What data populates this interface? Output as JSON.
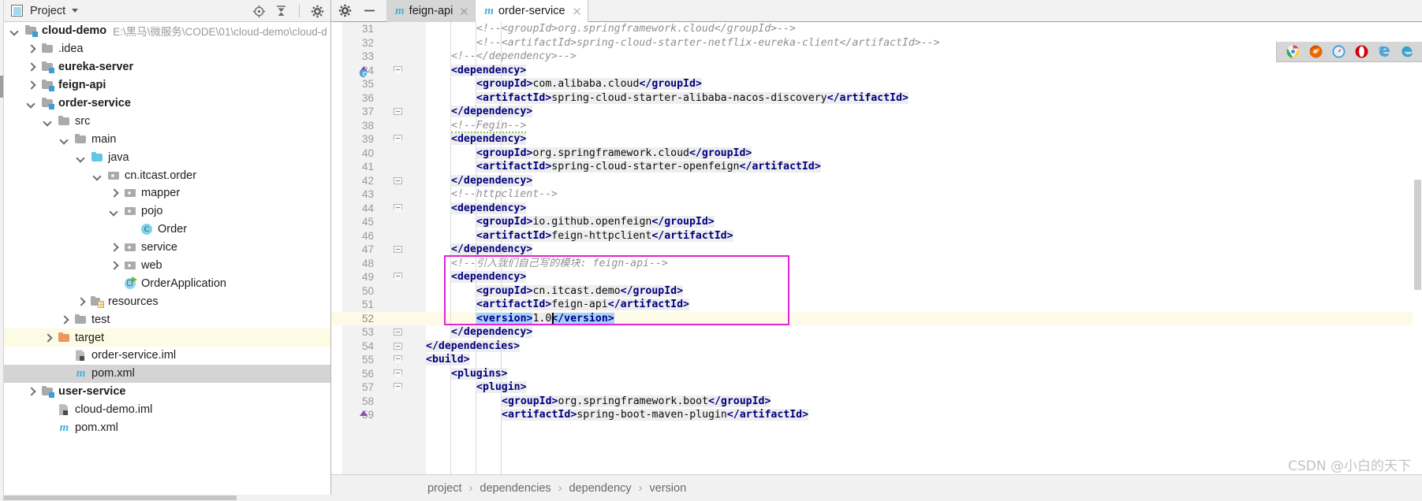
{
  "project_panel": {
    "title": "Project",
    "icons": [
      {
        "name": "locate-icon",
        "glyph": "target"
      },
      {
        "name": "collapse-all-icon",
        "glyph": "collapse"
      },
      {
        "name": "settings-gear-icon",
        "glyph": "gear"
      },
      {
        "name": "hide-icon",
        "glyph": "minus"
      }
    ],
    "tree": [
      {
        "label": "cloud-demo",
        "path": "E:\\黑马\\微服务\\CODE\\01\\cloud-demo\\cloud-d",
        "indent": 0,
        "arrow": "down",
        "icon": "module-folder-icon",
        "bold": true,
        "state": "none"
      },
      {
        "label": ".idea",
        "path": "",
        "indent": 1,
        "arrow": "right",
        "icon": "folder-icon",
        "bold": false,
        "state": "none"
      },
      {
        "label": "eureka-server",
        "path": "",
        "indent": 1,
        "arrow": "right",
        "icon": "module-folder-icon",
        "bold": true,
        "state": "none"
      },
      {
        "label": "feign-api",
        "path": "",
        "indent": 1,
        "arrow": "right",
        "icon": "module-folder-icon",
        "bold": true,
        "state": "none"
      },
      {
        "label": "order-service",
        "path": "",
        "indent": 1,
        "arrow": "down",
        "icon": "module-folder-icon",
        "bold": true,
        "state": "none"
      },
      {
        "label": "src",
        "path": "",
        "indent": 2,
        "arrow": "down",
        "icon": "folder-icon",
        "bold": false,
        "state": "none"
      },
      {
        "label": "main",
        "path": "",
        "indent": 3,
        "arrow": "down",
        "icon": "folder-icon",
        "bold": false,
        "state": "none"
      },
      {
        "label": "java",
        "path": "",
        "indent": 4,
        "arrow": "down",
        "icon": "source-folder-icon",
        "bold": false,
        "state": "none"
      },
      {
        "label": "cn.itcast.order",
        "path": "",
        "indent": 5,
        "arrow": "down",
        "icon": "package-icon",
        "bold": false,
        "state": "none"
      },
      {
        "label": "mapper",
        "path": "",
        "indent": 6,
        "arrow": "right",
        "icon": "package-icon",
        "bold": false,
        "state": "none"
      },
      {
        "label": "pojo",
        "path": "",
        "indent": 6,
        "arrow": "down",
        "icon": "package-icon",
        "bold": false,
        "state": "none"
      },
      {
        "label": "Order",
        "path": "",
        "indent": 7,
        "arrow": "none",
        "icon": "java-class-icon",
        "bold": false,
        "state": "none"
      },
      {
        "label": "service",
        "path": "",
        "indent": 6,
        "arrow": "right",
        "icon": "package-icon",
        "bold": false,
        "state": "none"
      },
      {
        "label": "web",
        "path": "",
        "indent": 6,
        "arrow": "right",
        "icon": "package-icon",
        "bold": false,
        "state": "none"
      },
      {
        "label": "OrderApplication",
        "path": "",
        "indent": 6,
        "arrow": "none",
        "icon": "spring-boot-class-icon",
        "bold": false,
        "state": "none"
      },
      {
        "label": "resources",
        "path": "",
        "indent": 4,
        "arrow": "right",
        "icon": "resources-folder-icon",
        "bold": false,
        "state": "none"
      },
      {
        "label": "test",
        "path": "",
        "indent": 3,
        "arrow": "right",
        "icon": "folder-icon",
        "bold": false,
        "state": "none"
      },
      {
        "label": "target",
        "path": "",
        "indent": 2,
        "arrow": "right",
        "icon": "target-folder-icon",
        "bold": false,
        "state": "yellow"
      },
      {
        "label": "order-service.iml",
        "path": "",
        "indent": 3,
        "arrow": "none",
        "icon": "iml-file-icon",
        "bold": false,
        "state": "none"
      },
      {
        "label": "pom.xml",
        "path": "",
        "indent": 3,
        "arrow": "none",
        "icon": "maven-file-icon",
        "bold": false,
        "state": "selected"
      },
      {
        "label": "user-service",
        "path": "",
        "indent": 1,
        "arrow": "right",
        "icon": "module-folder-icon",
        "bold": true,
        "state": "none"
      },
      {
        "label": "cloud-demo.iml",
        "path": "",
        "indent": 2,
        "arrow": "none",
        "icon": "iml-file-icon",
        "bold": false,
        "state": "none"
      },
      {
        "label": "pom.xml",
        "path": "",
        "indent": 2,
        "arrow": "none",
        "icon": "maven-file-icon",
        "bold": false,
        "state": "none"
      }
    ]
  },
  "editor": {
    "tabs": [
      {
        "label": "feign-api",
        "icon": "maven-file-icon",
        "active": false
      },
      {
        "label": "order-service",
        "icon": "maven-file-icon",
        "active": true
      }
    ],
    "toolbar_icons": [
      {
        "name": "settings-gear-icon"
      },
      {
        "name": "hide-window-icon"
      }
    ],
    "browser_icons": [
      {
        "name": "chrome-browser-icon",
        "color": "#4caf50"
      },
      {
        "name": "firefox-browser-icon",
        "color": "#e8650d"
      },
      {
        "name": "safari-browser-icon",
        "color": "#3f9ee0"
      },
      {
        "name": "opera-browser-icon",
        "color": "#d4000f"
      },
      {
        "name": "internet-explorer-browser-icon",
        "color": "#4ba3d8"
      },
      {
        "name": "edge-browser-icon",
        "color": "#2fa3d6"
      }
    ],
    "first_line_number": 31,
    "highlighted_line": 52,
    "caret_line": 52,
    "lines": [
      {
        "n": 31,
        "indent": 2,
        "fold": "none",
        "marker": "none",
        "tokens": [
          {
            "t": "cmt",
            "s": "<!--<groupId>org.springframework.cloud</groupId>-->"
          }
        ]
      },
      {
        "n": 32,
        "indent": 2,
        "fold": "none",
        "marker": "none",
        "tokens": [
          {
            "t": "cmt",
            "s": "<!--<artifactId>spring-cloud-starter-netflix-eureka-client</artifactId>-->"
          }
        ]
      },
      {
        "n": 33,
        "indent": 1,
        "fold": "none",
        "marker": "none",
        "tokens": [
          {
            "t": "cmt",
            "s": "<!--</dependency>-->"
          }
        ]
      },
      {
        "n": 34,
        "indent": 1,
        "fold": "v",
        "marker": "run-gutter",
        "tokens": [
          {
            "t": "tag",
            "s": "<dependency>"
          }
        ]
      },
      {
        "n": 35,
        "indent": 2,
        "fold": "none",
        "marker": "none",
        "tokens": [
          {
            "t": "tag",
            "s": "<groupId>"
          },
          {
            "t": "val",
            "s": "com.alibaba.cloud"
          },
          {
            "t": "tag",
            "s": "</groupId>"
          }
        ]
      },
      {
        "n": 36,
        "indent": 2,
        "fold": "none",
        "marker": "none",
        "tokens": [
          {
            "t": "tag",
            "s": "<artifactId>"
          },
          {
            "t": "val",
            "s": "spring-cloud-starter-alibaba-nacos-discovery"
          },
          {
            "t": "tag",
            "s": "</artifactId>"
          }
        ]
      },
      {
        "n": 37,
        "indent": 1,
        "fold": "minus",
        "marker": "none",
        "tokens": [
          {
            "t": "tag",
            "s": "</dependency>"
          }
        ]
      },
      {
        "n": 38,
        "indent": 1,
        "fold": "none",
        "marker": "none",
        "tokens": [
          {
            "t": "cmt-squig",
            "s": "<!--Fegin-->"
          }
        ]
      },
      {
        "n": 39,
        "indent": 1,
        "fold": "v",
        "marker": "none",
        "tokens": [
          {
            "t": "tag",
            "s": "<dependency>"
          }
        ]
      },
      {
        "n": 40,
        "indent": 2,
        "fold": "none",
        "marker": "none",
        "tokens": [
          {
            "t": "tag",
            "s": "<groupId>"
          },
          {
            "t": "val",
            "s": "org.springframework.cloud"
          },
          {
            "t": "tag",
            "s": "</groupId>"
          }
        ]
      },
      {
        "n": 41,
        "indent": 2,
        "fold": "none",
        "marker": "none",
        "tokens": [
          {
            "t": "tag",
            "s": "<artifactId>"
          },
          {
            "t": "val",
            "s": "spring-cloud-starter-openfeign"
          },
          {
            "t": "tag",
            "s": "</artifactId>"
          }
        ]
      },
      {
        "n": 42,
        "indent": 1,
        "fold": "minus",
        "marker": "none",
        "tokens": [
          {
            "t": "tag",
            "s": "</dependency>"
          }
        ]
      },
      {
        "n": 43,
        "indent": 1,
        "fold": "none",
        "marker": "none",
        "tokens": [
          {
            "t": "cmt",
            "s": "<!--httpclient-->"
          }
        ]
      },
      {
        "n": 44,
        "indent": 1,
        "fold": "v",
        "marker": "none",
        "tokens": [
          {
            "t": "tag",
            "s": "<dependency>"
          }
        ]
      },
      {
        "n": 45,
        "indent": 2,
        "fold": "none",
        "marker": "none",
        "tokens": [
          {
            "t": "tag",
            "s": "<groupId>"
          },
          {
            "t": "val",
            "s": "io.github.openfeign"
          },
          {
            "t": "tag",
            "s": "</groupId>"
          }
        ]
      },
      {
        "n": 46,
        "indent": 2,
        "fold": "none",
        "marker": "none",
        "tokens": [
          {
            "t": "tag",
            "s": "<artifactId>"
          },
          {
            "t": "val",
            "s": "feign-httpclient"
          },
          {
            "t": "tag",
            "s": "</artifactId>"
          }
        ]
      },
      {
        "n": 47,
        "indent": 1,
        "fold": "minus",
        "marker": "none",
        "tokens": [
          {
            "t": "tag",
            "s": "</dependency>"
          }
        ]
      },
      {
        "n": 48,
        "indent": 1,
        "fold": "none",
        "marker": "none",
        "tokens": [
          {
            "t": "cmt",
            "s": "<!--引入我们自己写的模块: feign-api-->"
          }
        ]
      },
      {
        "n": 49,
        "indent": 1,
        "fold": "v",
        "marker": "none",
        "tokens": [
          {
            "t": "tag",
            "s": "<dependency>"
          }
        ]
      },
      {
        "n": 50,
        "indent": 2,
        "fold": "none",
        "marker": "none",
        "tokens": [
          {
            "t": "tag",
            "s": "<groupId>"
          },
          {
            "t": "val",
            "s": "cn.itcast.demo"
          },
          {
            "t": "tag",
            "s": "</groupId>"
          }
        ]
      },
      {
        "n": 51,
        "indent": 2,
        "fold": "none",
        "marker": "none",
        "tokens": [
          {
            "t": "tag",
            "s": "<artifactId>"
          },
          {
            "t": "val",
            "s": "feign-api"
          },
          {
            "t": "tag",
            "s": "</artifactId>"
          }
        ]
      },
      {
        "n": 52,
        "indent": 2,
        "fold": "none",
        "marker": "none",
        "tokens": [
          {
            "t": "tag-sel",
            "s": "<version>"
          },
          {
            "t": "val",
            "s": "1.0"
          },
          {
            "t": "tag-sel",
            "s": "</version>"
          }
        ]
      },
      {
        "n": 53,
        "indent": 1,
        "fold": "minus",
        "marker": "none",
        "tokens": [
          {
            "t": "tag",
            "s": "</dependency>"
          }
        ]
      },
      {
        "n": 54,
        "indent": 0,
        "fold": "minus",
        "marker": "none",
        "tokens": [
          {
            "t": "tag",
            "s": "</dependencies>"
          }
        ]
      },
      {
        "n": 55,
        "indent": 0,
        "fold": "v",
        "marker": "none",
        "tokens": [
          {
            "t": "tag",
            "s": "<build>"
          }
        ]
      },
      {
        "n": 56,
        "indent": 1,
        "fold": "v",
        "marker": "none",
        "tokens": [
          {
            "t": "tag",
            "s": "<plugins>"
          }
        ]
      },
      {
        "n": 57,
        "indent": 2,
        "fold": "v",
        "marker": "none",
        "tokens": [
          {
            "t": "tag",
            "s": "<plugin>"
          }
        ]
      },
      {
        "n": 58,
        "indent": 3,
        "fold": "none",
        "marker": "none",
        "tokens": [
          {
            "t": "tag",
            "s": "<groupId>"
          },
          {
            "t": "val",
            "s": "org.springframework.boot"
          },
          {
            "t": "tag",
            "s": "</groupId>"
          }
        ]
      },
      {
        "n": 59,
        "indent": 3,
        "fold": "none",
        "marker": "arrow-up",
        "tokens": [
          {
            "t": "tag",
            "s": "<artifactId>"
          },
          {
            "t": "val",
            "s": "spring-boot-maven-plugin"
          },
          {
            "t": "tag",
            "s": "</artifactId>"
          }
        ]
      }
    ],
    "annotation_box_color": "#e321d6",
    "breadcrumb": [
      "project",
      "dependencies",
      "dependency",
      "version"
    ],
    "breadcrumb_separator": "›"
  },
  "watermark": "CSDN @小白的天下"
}
